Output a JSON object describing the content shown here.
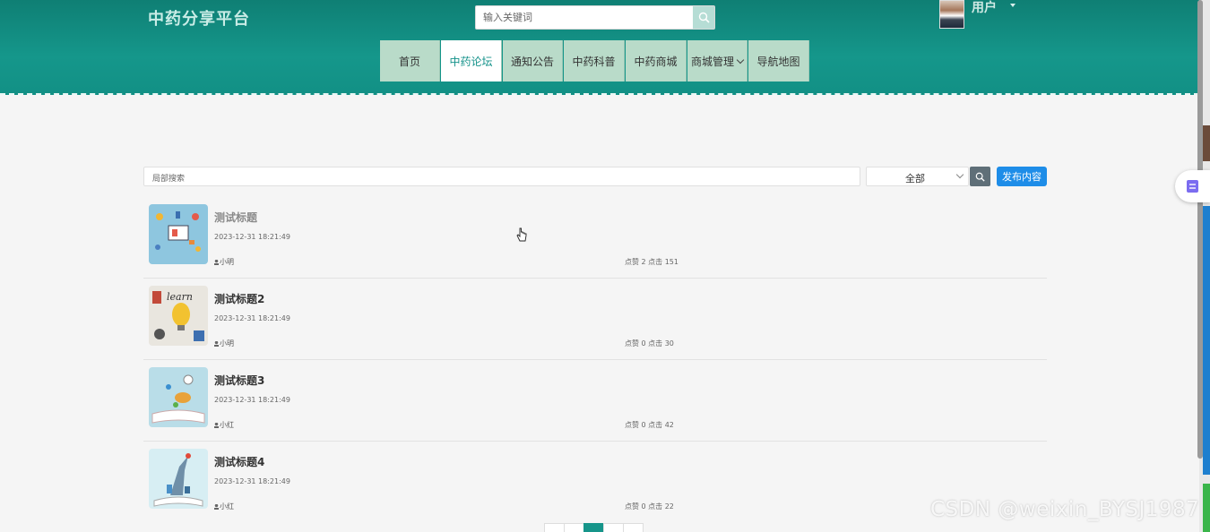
{
  "header": {
    "brand": "中药分享平台",
    "search_placeholder": "输入关键词",
    "user_label": "用户"
  },
  "nav": {
    "items": [
      {
        "label": "首页"
      },
      {
        "label": "中药论坛"
      },
      {
        "label": "通知公告"
      },
      {
        "label": "中药科普"
      },
      {
        "label": "中药商城"
      },
      {
        "label": "商城管理"
      },
      {
        "label": "导航地图"
      }
    ],
    "active_index": 1
  },
  "toolbar": {
    "local_search_placeholder": "局部搜索",
    "category_selected": "全部",
    "publish_label": "发布内容"
  },
  "posts": [
    {
      "title": "测试标题",
      "date": "2023-12-31 18:21:49",
      "author": "小明",
      "stats": "点赞 2 点击 151"
    },
    {
      "title": "测试标题2",
      "date": "2023-12-31 18:21:49",
      "author": "小明",
      "stats": "点赞 0 点击 30"
    },
    {
      "title": "测试标题3",
      "date": "2023-12-31 18:21:49",
      "author": "小红",
      "stats": "点赞 0 点击 42"
    },
    {
      "title": "测试标题4",
      "date": "2023-12-31 18:21:49",
      "author": "小红",
      "stats": "点赞 0 点击 22"
    }
  ],
  "colors": {
    "header": "#15978b",
    "nav_bg": "#b9dbc9",
    "accent": "#1e8de8"
  },
  "watermark": "CSDN @weixin_BYSJ1987"
}
